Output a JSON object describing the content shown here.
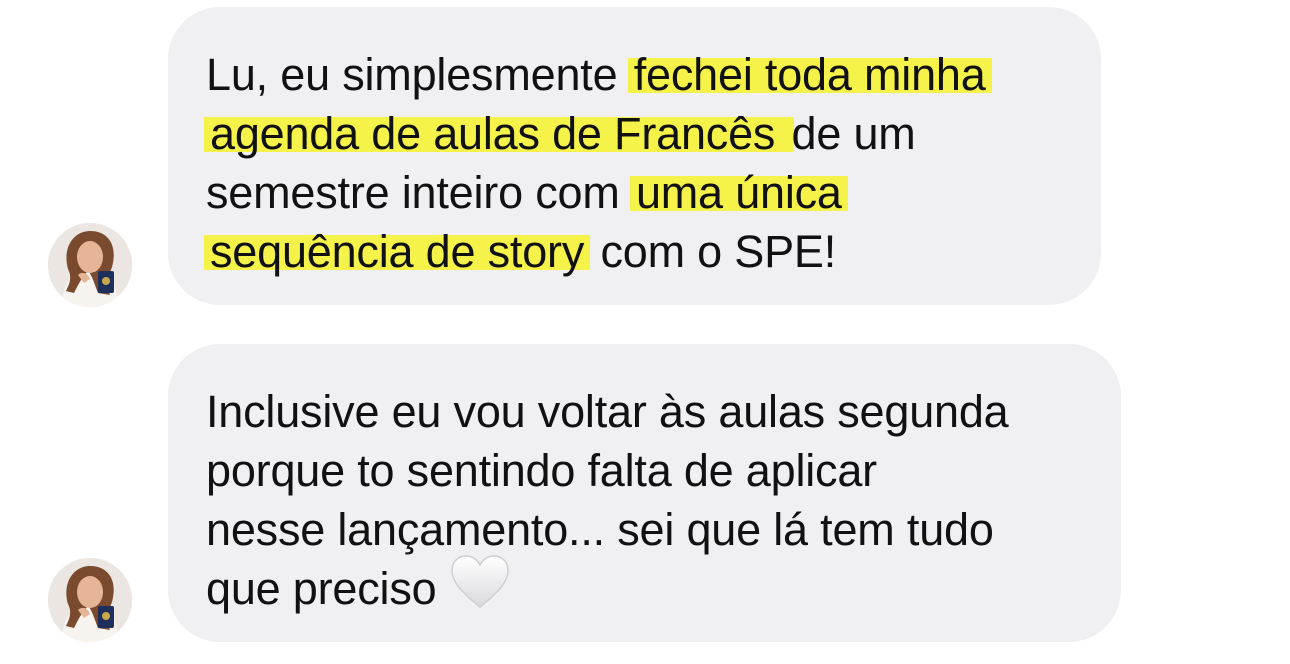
{
  "conversation": {
    "messages": [
      {
        "avatar": "profile-photo-avatar",
        "lines": [
          {
            "plain": "Lu, eu simplesmente ",
            "highlight": "fechei toda minha",
            "after": ""
          },
          {
            "plain": "",
            "highlight": "agenda de aulas de Francês ",
            "after": " de um"
          },
          {
            "plain": "semestre inteiro com ",
            "highlight": "uma única ",
            "after": ""
          },
          {
            "plain": "",
            "highlight": "sequência de story",
            "after": " com o SPE!"
          }
        ]
      },
      {
        "avatar": "profile-photo-avatar",
        "lines": [
          {
            "text": "Inclusive eu vou voltar às aulas segunda"
          },
          {
            "text": "porque to sentindo falta de aplicar"
          },
          {
            "text": "nesse lançamento... sei que lá tem tudo"
          },
          {
            "text": "que preciso",
            "emoji": "white-heart-icon"
          }
        ]
      }
    ],
    "colors": {
      "bubble_bg": "#f0f0f2",
      "highlight": "#f5f24a",
      "text": "#111111"
    }
  }
}
